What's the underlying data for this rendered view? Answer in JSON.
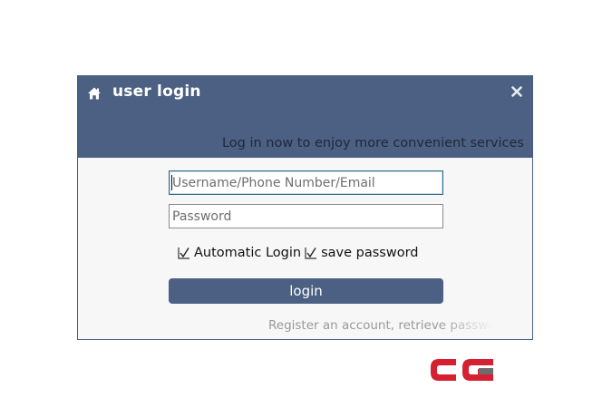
{
  "dialog": {
    "title": "user login",
    "subtitle": "Log in now to enjoy more convenient services",
    "icons": {
      "home": "home-icon",
      "close": "close-icon"
    }
  },
  "form": {
    "username": {
      "placeholder": "Username/Phone Number/Email",
      "value": ""
    },
    "password": {
      "placeholder": "Password",
      "value": ""
    },
    "options": [
      {
        "label": "Automatic Login",
        "checked": true
      },
      {
        "label": "save password",
        "checked": true
      }
    ],
    "login_label": "login",
    "links_text": "Register an account, retrieve password"
  },
  "watermark": {
    "logo_text": "CG",
    "colors": {
      "red": "#d42030",
      "gray": "#6d6d6d"
    }
  },
  "colors": {
    "header": "#4b6082",
    "body": "#f7f7f7",
    "button": "#4b6082"
  }
}
